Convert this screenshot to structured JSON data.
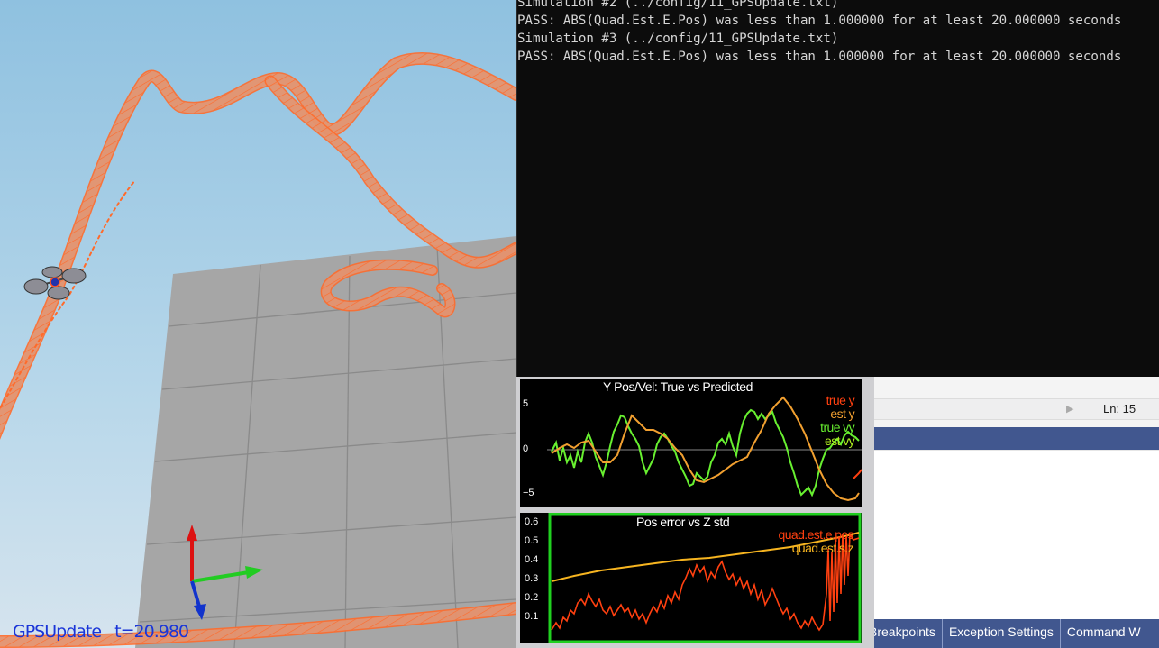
{
  "console": {
    "lines": [
      "Simulation #2 (../config/11_GPSUpdate.txt)",
      "PASS: ABS(Quad.Est.E.Pos) was less than 1.000000 for at least 20.000000 seconds",
      "Simulation #3 (../config/11_GPSUpdate.txt)",
      "PASS: ABS(Quad.Est.E.Pos) was less than 1.000000 for at least 20.000000 seconds"
    ]
  },
  "simulator": {
    "scenario_label": "GPSUpdate   t=20.980"
  },
  "plot_yposvel": {
    "title": "Y Pos/Vel: True vs Predicted",
    "y_ticks": [
      "5",
      "0",
      "−5"
    ],
    "legend": [
      {
        "label": "true y",
        "color": "#ff4010"
      },
      {
        "label": "est y",
        "color": "#f2a030"
      },
      {
        "label": "true vy",
        "color": "#68f030"
      },
      {
        "label": "est vy",
        "color": "#b0f020"
      }
    ]
  },
  "plot_poserror": {
    "title": "Pos error vs Z std",
    "y_ticks": [
      "0.6",
      "0.5",
      "0.4",
      "0.3",
      "0.2",
      "0.1"
    ],
    "legend": [
      {
        "label": "quad.est.e.pos",
        "color": "#ff4010"
      },
      {
        "label": "quad.est.s.z",
        "color": "#f7b520"
      }
    ]
  },
  "ide": {
    "line_indicator": "Ln: 15",
    "tabs": [
      "Breakpoints",
      "Exception Settings",
      "Command W"
    ]
  },
  "colors": {
    "trajectory": "#ff6a2a",
    "console_bg": "#0c0c0c",
    "ide_tabbar": "#41578f",
    "sky": "#9fc9e3"
  }
}
